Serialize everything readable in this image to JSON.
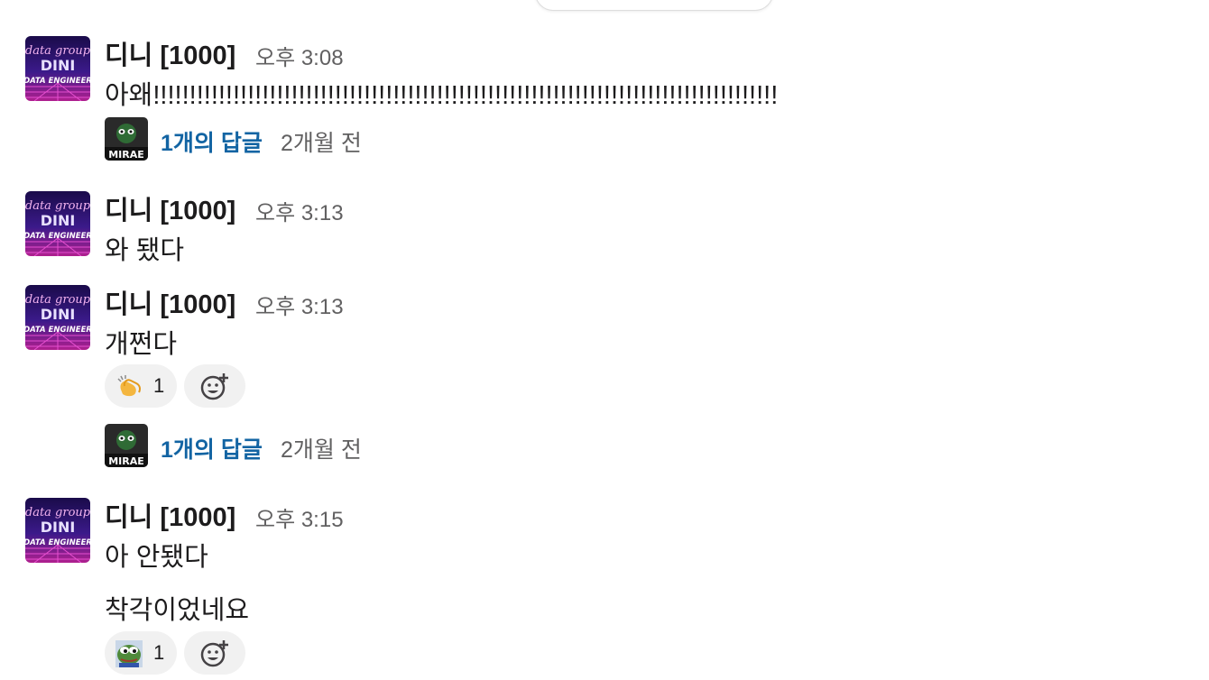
{
  "brand": {
    "link_color": "#1264a3",
    "muted_color": "#616061",
    "text_color": "#1d1c1d"
  },
  "avatar": {
    "lines": [
      "data group",
      "DINI",
      "DATA ENGINEER"
    ]
  },
  "thread_avatar_label": "MIRAE",
  "messages": [
    {
      "author": "디니 [1000]",
      "time": "오후 3:08",
      "lines": [
        "아왜!!!!!!!!!!!!!!!!!!!!!!!!!!!!!!!!!!!!!!!!!!!!!!!!!!!!!!!!!!!!!!!!!!!!!!!!!!!!!!!!!!!!!!"
      ],
      "thread": {
        "count": "1개의 답글",
        "ago": "2개월 전"
      }
    },
    {
      "author": "디니 [1000]",
      "time": "오후 3:13",
      "lines": [
        "와 됐다"
      ]
    },
    {
      "author": "디니 [1000]",
      "time": "오후 3:13",
      "lines": [
        "개쩐다"
      ],
      "reaction": {
        "icon": "clapping-hands-icon",
        "count": "1"
      },
      "thread": {
        "count": "1개의 답글",
        "ago": "2개월 전"
      }
    },
    {
      "author": "디니 [1000]",
      "time": "오후 3:15",
      "lines": [
        "아 안됐다",
        "착각이었네요"
      ],
      "reaction": {
        "icon": "pepe-frog-icon",
        "count": "1"
      }
    }
  ]
}
